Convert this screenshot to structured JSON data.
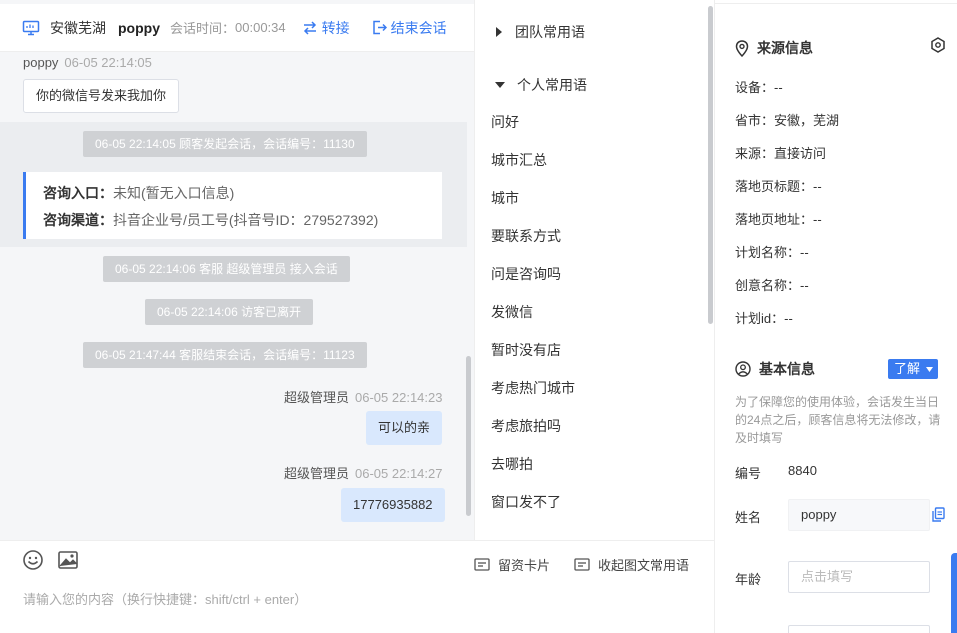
{
  "header": {
    "location": "安徽芜湖",
    "visitor_name": "poppy",
    "time_label": "会话时间：",
    "time_value": "00:00:34",
    "transfer_label": "转接",
    "end_label": "结束会话"
  },
  "messages": {
    "visitor_msg": {
      "sender": "poppy",
      "time": "06-05 22:14:05",
      "text": "你的微信号发来我加你"
    },
    "sys_start": "06-05 22:14:05 顾客发起会话，会话编号：11130",
    "info_card": {
      "entry_label": "咨询入口：",
      "entry_value": "未知(暂无入口信息)",
      "channel_label": "咨询渠道：",
      "channel_value": "抖音企业号/员工号(抖音号ID：279527392)"
    },
    "sys_join": "06-05 22:14:06 客服 超级管理员 接入会话",
    "sys_left": "06-05 22:14:06 访客已离开",
    "sys_end": "06-05 21:47:44 客服结束会话，会话编号：11123",
    "agent_msg_1": {
      "sender": "超级管理员",
      "time": "06-05 22:14:23",
      "text": "可以的亲"
    },
    "agent_msg_2": {
      "sender": "超级管理员",
      "time": "06-05 22:14:27",
      "text": "17776935882"
    }
  },
  "composer": {
    "card_label": "留资卡片",
    "collapse_label": "收起图文常用语",
    "placeholder": "请输入您的内容（换行快捷键：shift/ctrl + enter）"
  },
  "phrases": {
    "team_group": "团队常用语",
    "personal_group": "个人常用语",
    "items": [
      "问好",
      "城市汇总",
      "城市",
      "要联系方式",
      "问是咨询吗",
      "发微信",
      "暂时没有店",
      "考虑热门城市",
      "考虑旅拍吗",
      "去哪拍",
      "窗口发不了"
    ]
  },
  "source_info": {
    "title": "来源信息",
    "rows": [
      "设备：--",
      "省市：安徽，芜湖",
      "来源：直接访问",
      "落地页标题：--",
      "落地页地址：--",
      "计划名称：--",
      "创意名称：--",
      "计划id：--"
    ]
  },
  "basic_info": {
    "title": "基本信息",
    "badge": "了解",
    "note": "为了保障您的使用体验，会话发生当日的24点之后，顾客信息将无法修改，请及时填写",
    "id_label": "编号",
    "id_value": "8840",
    "name_label": "姓名",
    "name_value": "poppy",
    "age_label": "年龄",
    "age_placeholder": "点击填写"
  },
  "colors": {
    "accent": "#3a7bf0",
    "system_pill": "#cfd1d4",
    "agent_bubble": "#d9e8fd"
  }
}
